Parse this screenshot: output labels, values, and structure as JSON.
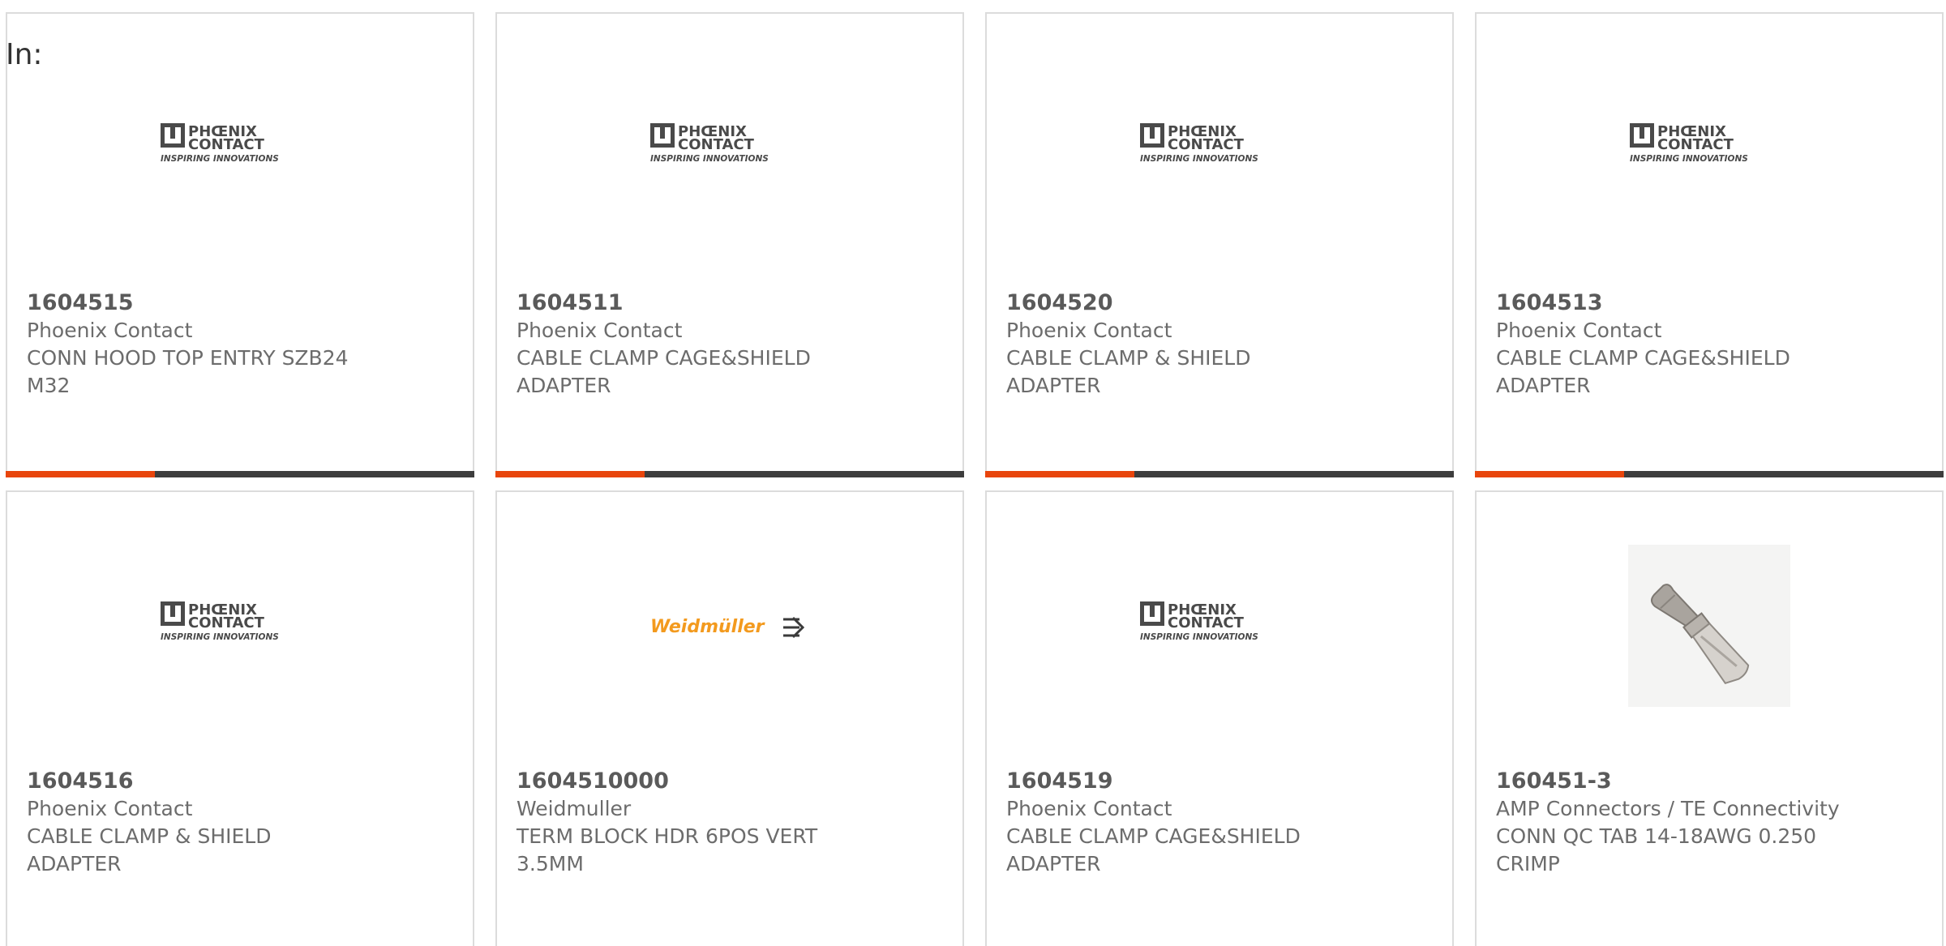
{
  "header": {
    "in_label": "In:"
  },
  "colors": {
    "accent": "#e8450c",
    "bar": "#3d3d3d",
    "border": "#dcdcdc",
    "phoenix_gray": "#4a4a4a",
    "weidmuller_orange": "#f39a1e"
  },
  "cards": [
    {
      "part_number": "1604515",
      "manufacturer": "Phoenix Contact",
      "description": "CONN HOOD TOP ENTRY SZB24 M32",
      "logo": "phoenix-contact-logo",
      "logo_text": {
        "line1": "PHŒNIX",
        "line2": "CONTACT",
        "tagline": "INSPIRING INNOVATIONS"
      }
    },
    {
      "part_number": "1604511",
      "manufacturer": "Phoenix Contact",
      "description": "CABLE CLAMP CAGE&SHIELD ADAPTER",
      "logo": "phoenix-contact-logo",
      "logo_text": {
        "line1": "PHŒNIX",
        "line2": "CONTACT",
        "tagline": "INSPIRING INNOVATIONS"
      }
    },
    {
      "part_number": "1604520",
      "manufacturer": "Phoenix Contact",
      "description": "CABLE CLAMP & SHIELD ADAPTER",
      "logo": "phoenix-contact-logo",
      "logo_text": {
        "line1": "PHŒNIX",
        "line2": "CONTACT",
        "tagline": "INSPIRING INNOVATIONS"
      }
    },
    {
      "part_number": "1604513",
      "manufacturer": "Phoenix Contact",
      "description": "CABLE CLAMP CAGE&SHIELD ADAPTER",
      "logo": "phoenix-contact-logo",
      "logo_text": {
        "line1": "PHŒNIX",
        "line2": "CONTACT",
        "tagline": "INSPIRING INNOVATIONS"
      }
    },
    {
      "part_number": "1604516",
      "manufacturer": "Phoenix Contact",
      "description": "CABLE CLAMP & SHIELD ADAPTER",
      "logo": "phoenix-contact-logo",
      "logo_text": {
        "line1": "PHŒNIX",
        "line2": "CONTACT",
        "tagline": "INSPIRING INNOVATIONS"
      }
    },
    {
      "part_number": "1604510000",
      "manufacturer": "Weidmuller",
      "description": "TERM BLOCK HDR 6POS VERT 3.5MM",
      "logo": "weidmuller-logo",
      "logo_text": {
        "line1": "Weidmüller"
      }
    },
    {
      "part_number": "1604519",
      "manufacturer": "Phoenix Contact",
      "description": "CABLE CLAMP CAGE&SHIELD ADAPTER",
      "logo": "phoenix-contact-logo",
      "logo_text": {
        "line1": "PHŒNIX",
        "line2": "CONTACT",
        "tagline": "INSPIRING INNOVATIONS"
      }
    },
    {
      "part_number": "160451-3",
      "manufacturer": "AMP Connectors / TE Connectivity",
      "description": "CONN QC TAB 14-18AWG 0.250 CRIMP",
      "logo": "crimp-terminal-photo",
      "logo_text": {}
    }
  ]
}
